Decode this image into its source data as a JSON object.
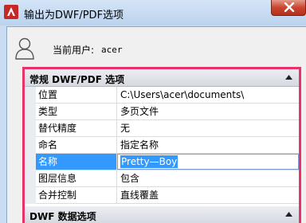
{
  "window": {
    "title": "输出为DWF/PDF选项",
    "accent_color": "#e8326a"
  },
  "user": {
    "label": "当前用户:",
    "value": "acer"
  },
  "sections": [
    {
      "title": "常规 DWF/PDF 选项",
      "rows": [
        {
          "key": "位置",
          "value": "C:\\Users\\acer\\documents\\"
        },
        {
          "key": "类型",
          "value": "多页文件"
        },
        {
          "key": "替代精度",
          "value": "无"
        },
        {
          "key": "命名",
          "value": "指定名称"
        },
        {
          "key": "名称",
          "value": "Pretty—Boy",
          "selected": true
        },
        {
          "key": "图层信息",
          "value": "包含"
        },
        {
          "key": "合并控制",
          "value": "直线覆盖"
        }
      ]
    },
    {
      "title": "DWF 数据选项",
      "rows": []
    }
  ]
}
